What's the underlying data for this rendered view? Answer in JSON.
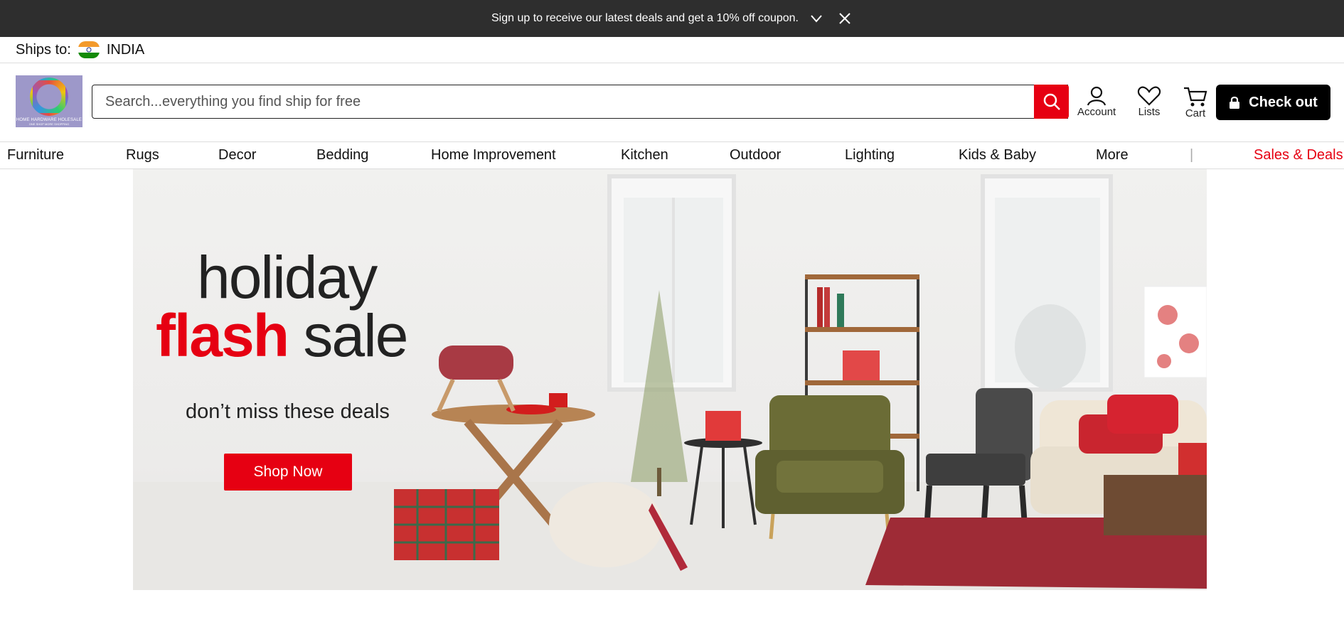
{
  "promo": {
    "text": "Sign up to receive our latest deals and get a 10% off coupon.",
    "expand_icon": "chevron-down-icon",
    "close_icon": "close-icon"
  },
  "ships": {
    "label": "Ships to:",
    "country": "INDIA",
    "flag_icon": "india-flag-icon"
  },
  "header": {
    "logo_line1": "HOME HARDWARE HOLESALE",
    "logo_line2": "ONE SHOP MORE SHOPPING",
    "search_placeholder": "Search...everything you find ship for free",
    "account_label": "Account",
    "lists_label": "Lists",
    "cart_label": "Cart",
    "checkout_label": "Check out"
  },
  "nav": {
    "items": [
      "Furniture",
      "Rugs",
      "Decor",
      "Bedding",
      "Home Improvement",
      "Kitchen",
      "Outdoor",
      "Lighting",
      "Kids & Baby",
      "More"
    ],
    "separator": "|",
    "deals": "Sales & Deals"
  },
  "hero": {
    "line1": "holiday",
    "line2_bold": "flash",
    "line2_rest": "sale",
    "subtitle": "don’t miss these deals",
    "cta": "Shop Now"
  },
  "colors": {
    "accent": "#e60012",
    "promo_bg": "#2e2e2e",
    "checkout_bg": "#000000"
  }
}
